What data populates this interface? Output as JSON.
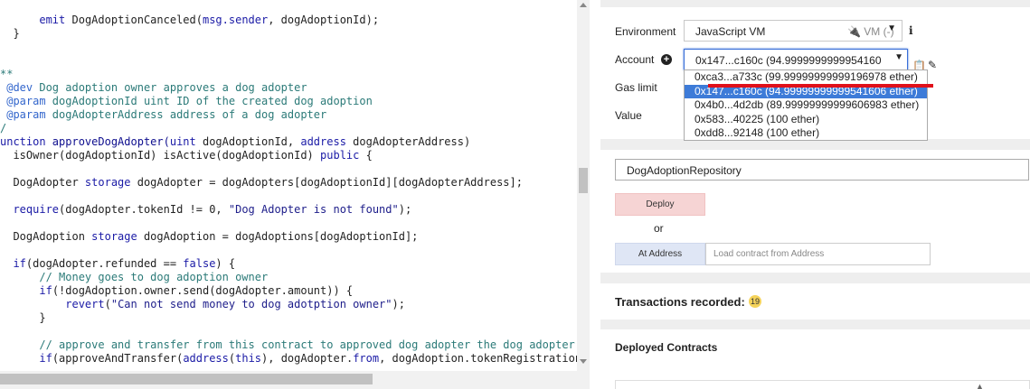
{
  "editor": {
    "lines": [
      [
        {
          "t": "      ",
          "c": "pl"
        },
        {
          "t": "emit",
          "c": "kw"
        },
        {
          "t": " DogAdoptionCanceled(",
          "c": "pl"
        },
        {
          "t": "msg.sender",
          "c": "kw"
        },
        {
          "t": ", dogAdoptionId);",
          "c": "pl"
        }
      ],
      [
        {
          "t": "  }",
          "c": "pl"
        }
      ],
      [
        {
          "t": "",
          "c": "pl"
        }
      ],
      [
        {
          "t": "",
          "c": "pl"
        }
      ],
      [
        {
          "t": "**",
          "c": "cm"
        }
      ],
      [
        {
          "t": " @dev ",
          "c": "cmk"
        },
        {
          "t": "Dog adoption owner approves a dog adopter",
          "c": "cm"
        }
      ],
      [
        {
          "t": " @param ",
          "c": "cmk"
        },
        {
          "t": "dogAdoptionId uint ID of the created dog adoption",
          "c": "cm"
        }
      ],
      [
        {
          "t": " @param ",
          "c": "cmk"
        },
        {
          "t": "dogAdopterAddress address of a dog adopter",
          "c": "cm"
        }
      ],
      [
        {
          "t": "/",
          "c": "cm"
        }
      ],
      [
        {
          "t": "unction ",
          "c": "kw"
        },
        {
          "t": "approveDogAdopter(",
          "c": "fn"
        },
        {
          "t": "uint",
          "c": "ty"
        },
        {
          "t": " dogAdoptionId, ",
          "c": "pl"
        },
        {
          "t": "address",
          "c": "ty"
        },
        {
          "t": " dogAdopterAddress)",
          "c": "pl"
        }
      ],
      [
        {
          "t": "  isOwner(dogAdoptionId) isActive(dogAdoptionId) ",
          "c": "pl"
        },
        {
          "t": "public",
          "c": "kw"
        },
        {
          "t": " {",
          "c": "pl"
        }
      ],
      [
        {
          "t": "",
          "c": "pl"
        }
      ],
      [
        {
          "t": "  DogAdopter ",
          "c": "pl"
        },
        {
          "t": "storage",
          "c": "kw"
        },
        {
          "t": " dogAdopter = dogAdopters[dogAdoptionId][dogAdopterAddress];",
          "c": "pl"
        }
      ],
      [
        {
          "t": "",
          "c": "pl"
        }
      ],
      [
        {
          "t": "  ",
          "c": "pl"
        },
        {
          "t": "require",
          "c": "kw"
        },
        {
          "t": "(dogAdopter.tokenId != 0, ",
          "c": "pl"
        },
        {
          "t": "\"Dog Adopter is not found\"",
          "c": "str"
        },
        {
          "t": ");",
          "c": "pl"
        }
      ],
      [
        {
          "t": "",
          "c": "pl"
        }
      ],
      [
        {
          "t": "  DogAdoption ",
          "c": "pl"
        },
        {
          "t": "storage",
          "c": "kw"
        },
        {
          "t": " dogAdoption = dogAdoptions[dogAdoptionId];",
          "c": "pl"
        }
      ],
      [
        {
          "t": "",
          "c": "pl"
        }
      ],
      [
        {
          "t": "  ",
          "c": "pl"
        },
        {
          "t": "if",
          "c": "kw"
        },
        {
          "t": "(dogAdopter.refunded == ",
          "c": "pl"
        },
        {
          "t": "false",
          "c": "kw"
        },
        {
          "t": ") {",
          "c": "pl"
        }
      ],
      [
        {
          "t": "      // Money goes to dog adoption owner",
          "c": "cm"
        }
      ],
      [
        {
          "t": "      ",
          "c": "pl"
        },
        {
          "t": "if",
          "c": "kw"
        },
        {
          "t": "(!dogAdoption.owner.send(dogAdopter.amount)) {",
          "c": "pl"
        }
      ],
      [
        {
          "t": "          ",
          "c": "pl"
        },
        {
          "t": "revert",
          "c": "kw"
        },
        {
          "t": "(",
          "c": "pl"
        },
        {
          "t": "\"Can not send money to dog adotption owner\"",
          "c": "str"
        },
        {
          "t": ");",
          "c": "pl"
        }
      ],
      [
        {
          "t": "      }",
          "c": "pl"
        }
      ],
      [
        {
          "t": "",
          "c": "pl"
        }
      ],
      [
        {
          "t": "      // approve and transfer from this contract to approved dog adopter the dog adopter",
          "c": "cm"
        }
      ],
      [
        {
          "t": "      ",
          "c": "pl"
        },
        {
          "t": "if",
          "c": "kw"
        },
        {
          "t": "(approveAndTransfer(",
          "c": "pl"
        },
        {
          "t": "address",
          "c": "ty"
        },
        {
          "t": "(",
          "c": "pl"
        },
        {
          "t": "this",
          "c": "kw"
        },
        {
          "t": "), dogAdopter.",
          "c": "pl"
        },
        {
          "t": "from",
          "c": "kw"
        },
        {
          "t": ", dogAdoption.tokenRegistration",
          "c": "pl"
        }
      ]
    ]
  },
  "run": {
    "environment_label": "Environment",
    "environment_value": "JavaScript VM",
    "environment_vm": "VM (-)",
    "account_label": "Account",
    "account_value": "0x147...c160c (94.9999999999954160",
    "gas_limit_label": "Gas limit",
    "value_label": "Value",
    "accounts": [
      "0xca3...a733c (99.99999999999196978 ether)",
      "0x147...c160c (94.99999999999541606 ether)",
      "0x4b0...4d2db (89.99999999999606983 ether)",
      "0x583...40225 (100 ether)",
      "0xdd8...92148 (100 ether)"
    ],
    "selected_account_index": 1
  },
  "compile": {
    "contract_name": "DogAdoptionRepository",
    "deploy_label": "Deploy",
    "or_label": "or",
    "at_address_label": "At Address",
    "at_address_placeholder": "Load contract from Address"
  },
  "transactions": {
    "title": "Transactions recorded:",
    "count": "19"
  },
  "deployed": {
    "title": "Deployed Contracts"
  },
  "colors": {
    "accent_blue": "#3d7bd8",
    "deploy_bg": "#f6d4d4",
    "at_address_bg": "#dfe6f5",
    "badge": "#f5d35a",
    "annotation_red": "#e0101a"
  }
}
